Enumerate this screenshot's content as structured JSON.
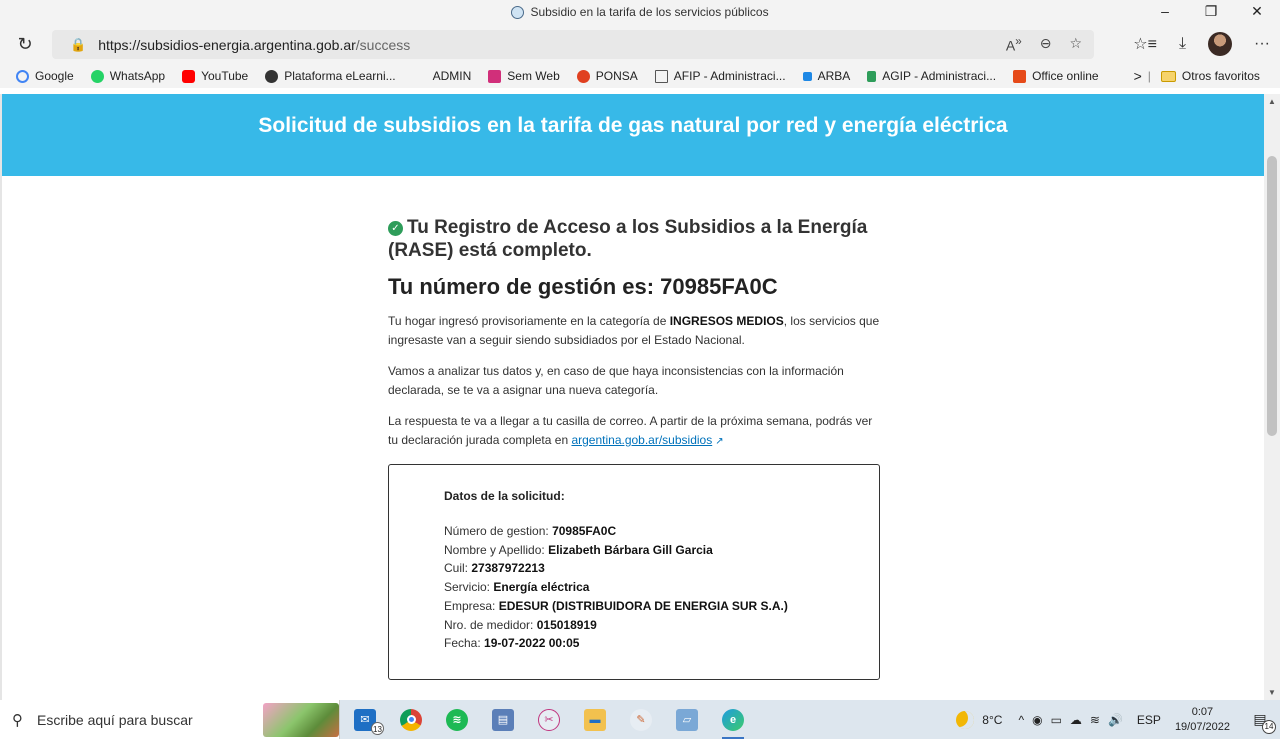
{
  "window": {
    "title": "Subsidio en la tarifa de los servicios públicos",
    "controls": [
      "–",
      "❐",
      "✕"
    ]
  },
  "navbar": {
    "url_host": "https://subsidios-energia.argentina.gob.ar",
    "url_path": "/success",
    "reload_icon": "reload-icon"
  },
  "bookmarks": {
    "items": [
      {
        "label": "Google",
        "color": "#4285f4"
      },
      {
        "label": "WhatsApp",
        "color": "#25d366"
      },
      {
        "label": "YouTube",
        "color": "#ff0000"
      },
      {
        "label": "Plataforma eLearni...",
        "color": "#333333"
      },
      {
        "label": "ADMIN",
        "color": ""
      },
      {
        "label": "Sem Web",
        "color": "#d12f7a"
      },
      {
        "label": "PONSA",
        "color": "#e04020"
      },
      {
        "label": "AFIP - Administraci...",
        "color": "#555555"
      },
      {
        "label": "ARBA",
        "color": "#1e88e5"
      },
      {
        "label": "AGIP - Administraci...",
        "color": "#2e9d5a"
      },
      {
        "label": "Office online",
        "color": "#e64a19"
      }
    ],
    "overflow": ">",
    "other_favorites": "Otros favoritos"
  },
  "banner": {
    "title": "Solicitud de subsidios en la tarifa de gas natural por red y energía eléctrica",
    "color": "#37b9e8"
  },
  "main": {
    "rase_title": "Tu Registro de Acceso a los Subsidios a la Energía (RASE) está completo.",
    "gestion_title": "Tu número de gestión es: 70985FA0C",
    "p1_a": "Tu hogar ingresó provisoriamente en la categoría de ",
    "p1_bold": "INGRESOS MEDIOS",
    "p1_b": ", los servicios que ingresaste van a seguir siendo subsidiados por el Estado Nacional.",
    "p2": "Vamos a analizar tus datos y, en caso de que haya inconsistencias con la información declarada, se te va a asignar una nueva categoría.",
    "p3": "La respuesta te va a llegar a tu casilla de correo. A partir de la próxima semana, podrás ver tu declaración jurada completa en ",
    "link": "argentina.gob.ar/subsidios"
  },
  "solicitud": {
    "heading": "Datos de la solicitud:",
    "rows": [
      {
        "label": "Número de gestion: ",
        "value": "70985FA0C"
      },
      {
        "label": "Nombre y Apellido: ",
        "value": "Elizabeth Bárbara Gill Garcia"
      },
      {
        "label": "Cuil: ",
        "value": "27387972213"
      },
      {
        "label": "Servicio: ",
        "value": "Energía eléctrica"
      },
      {
        "label": "Empresa: ",
        "value": "EDESUR (DISTRIBUIDORA DE ENERGIA SUR S.A.)"
      },
      {
        "label": "Nro. de medidor: ",
        "value": "015018919"
      },
      {
        "label": "Fecha: ",
        "value": "19-07-2022 00:05"
      }
    ]
  },
  "taskbar": {
    "search_placeholder": "Escribe aquí para buscar",
    "mail_badge": "13",
    "weather": "8°C",
    "lang": "ESP",
    "time": "0:07",
    "date": "19/07/2022",
    "notifications": "14"
  }
}
